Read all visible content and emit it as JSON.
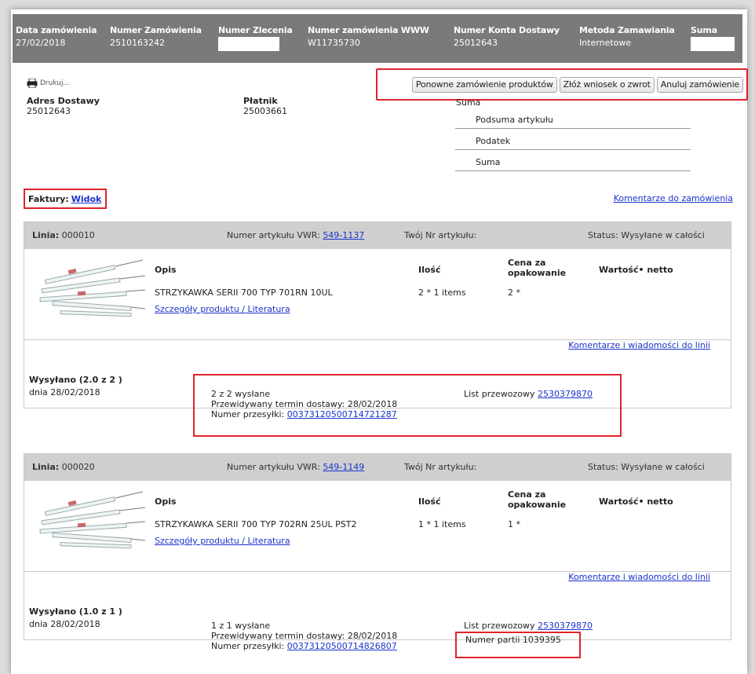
{
  "header": {
    "columns": [
      {
        "label": "Data zamówienia",
        "value": "27/02/2018"
      },
      {
        "label": "Numer Zamówienia",
        "value": "2510163242"
      },
      {
        "label": "Numer Zlecenia",
        "value": ""
      },
      {
        "label": "Numer zamówienia WWW",
        "value": "W11735730"
      },
      {
        "label": "Numer Konta Dostawy",
        "value": "25012643"
      },
      {
        "label": "Metoda Zamawiania",
        "value": "Internetowe"
      },
      {
        "label": "Suma",
        "value": ""
      }
    ]
  },
  "print_label": "Drukuj...",
  "buttons": {
    "reorder": "Ponowne zamówienie produktów",
    "return": "Złóż wniosek o zwrot",
    "cancel": "Anuluj zamówienie"
  },
  "delivery_address": {
    "label": "Adres Dostawy",
    "value": "25012643"
  },
  "payer": {
    "label": "Płatnik",
    "value": "25003661"
  },
  "summary": {
    "title": "Suma",
    "rows": [
      "Podsuma artykułu",
      "Podatek",
      "Suma"
    ]
  },
  "invoices": {
    "label": "Faktury:",
    "link": "Widok"
  },
  "order_comments": "Komentarze do zamówienia",
  "lines": [
    {
      "line_label": "Linia:",
      "line_no": "000010",
      "vwr_label": "Numer artykułu VWR:",
      "vwr_no": "549-1137",
      "your_label": "Twój Nr artykułu:",
      "status_label": "Status:",
      "status": "Wysyłane w całości",
      "desc_head": "Opis",
      "qty_head": "Ilość",
      "price_head_1": "Cena za",
      "price_head_2": "opakowanie",
      "net_head": "Wartość• netto",
      "description": "STRZYKAWKA SERII 700 TYP 701RN 10UL",
      "qty": "2 * 1 items",
      "price": "2 *",
      "details_link": "Szczegóły produktu / Literatura",
      "line_comments": "Komentarze i wiadomości do linii",
      "shipped_title": "Wysyłano (2.0 z 2 )",
      "shipped_date": "dnia 28/02/2018",
      "shipped_qty": "2 z 2 wysłane",
      "expected": "Przewidywany termin dostawy: 28/02/2018",
      "tracking_label": "Numer przesyłki:",
      "tracking_no": "00373120500714721287",
      "waybill_label": "List przewozowy",
      "waybill_no": "2530379870",
      "batch_label": "",
      "batch_no": ""
    },
    {
      "line_label": "Linia:",
      "line_no": "000020",
      "vwr_label": "Numer artykułu VWR:",
      "vwr_no": "549-1149",
      "your_label": "Twój Nr artykułu:",
      "status_label": "Status:",
      "status": "Wysyłane w całości",
      "desc_head": "Opis",
      "qty_head": "Ilość",
      "price_head_1": "Cena za",
      "price_head_2": "opakowanie",
      "net_head": "Wartość• netto",
      "description": "STRZYKAWKA SERII 700 TYP 702RN 25UL PST2",
      "qty": "1 * 1 items",
      "price": "1 *",
      "details_link": "Szczegóły produktu / Literatura",
      "line_comments": "Komentarze i wiadomości do linii",
      "shipped_title": "Wysyłano (1.0 z 1 )",
      "shipped_date": "dnia 28/02/2018",
      "shipped_qty": "1 z 1 wysłane",
      "expected": "Przewidywany termin dostawy: 28/02/2018",
      "tracking_label": "Numer przesyłki:",
      "tracking_no": "00373120500714826807",
      "waybill_label": "List przewozowy",
      "waybill_no": "2530379870",
      "batch_label": "Numer partii",
      "batch_no": "1039395"
    }
  ],
  "colors": {
    "header_bg": "#7a7a7a",
    "line_head_bg": "#cfcfcf",
    "highlight": "#e0232b",
    "link": "#1a33cc"
  }
}
